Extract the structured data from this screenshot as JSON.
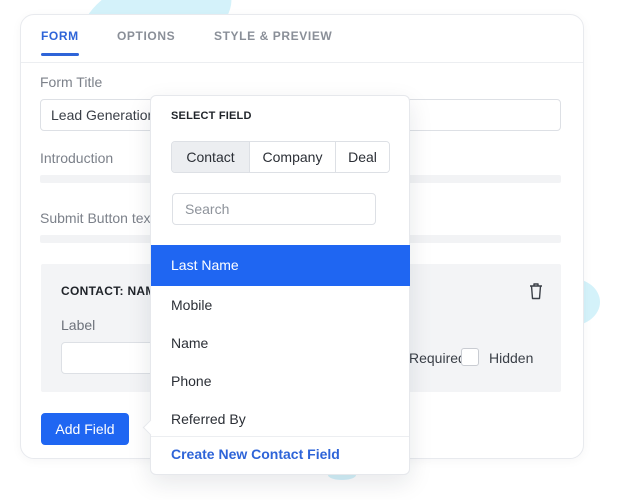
{
  "tabs": [
    {
      "label": "FORM",
      "active": true
    },
    {
      "label": "OPTIONS",
      "active": false
    },
    {
      "label": "STYLE & PREVIEW",
      "active": false
    }
  ],
  "form": {
    "title_label": "Form Title",
    "title_value": "Lead Generation",
    "introduction_label": "Introduction",
    "submit_label": "Submit Button text"
  },
  "field_box": {
    "title": "CONTACT: NAME",
    "label_label": "Label",
    "label_value": "",
    "required_label": "Required",
    "hidden_label": "Hidden",
    "hidden_checked": false,
    "delete_icon": "trash-icon"
  },
  "add_field_label": "Add Field",
  "dropdown": {
    "title": "SELECT FIELD",
    "segments": [
      {
        "label": "Contact",
        "active": true
      },
      {
        "label": "Company",
        "active": false
      },
      {
        "label": "Deal",
        "active": false
      }
    ],
    "search_placeholder": "Search",
    "items": [
      {
        "label": "Last Name",
        "active": true
      },
      {
        "label": "Mobile",
        "active": false
      },
      {
        "label": "Name",
        "active": false
      },
      {
        "label": "Phone",
        "active": false
      },
      {
        "label": "Referred By",
        "active": false
      }
    ],
    "create_label": "Create New Contact Field"
  },
  "colors": {
    "accent": "#1f66f2",
    "tab_active": "#2e64d8",
    "decor": "#d4f2fa"
  }
}
